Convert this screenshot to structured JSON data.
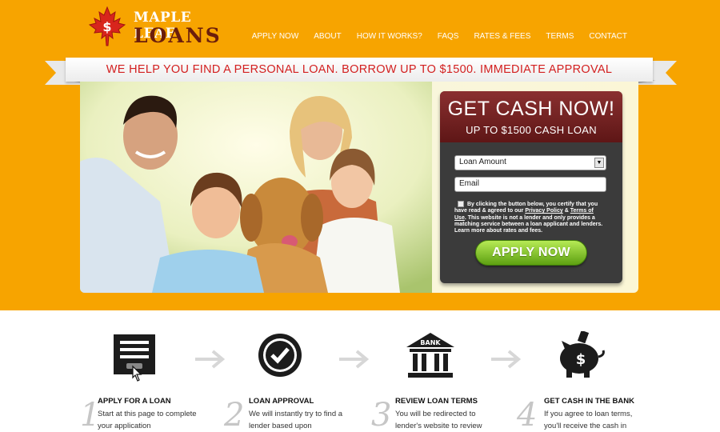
{
  "brand": {
    "line1": "MAPLE LEAF",
    "line2": "LOANS",
    "symbol": "$"
  },
  "nav": [
    "APPLY NOW",
    "ABOUT",
    "HOW IT WORKS?",
    "FAQS",
    "RATES & FEES",
    "TERMS",
    "CONTACT"
  ],
  "banner": "WE HELP YOU FIND A PERSONAL LOAN. BORROW UP TO $1500. IMMEDIATE APPROVAL",
  "form": {
    "title": "GET CASH NOW!",
    "subtitle": "UP TO $1500 CASH LOAN",
    "loan_amount": "Loan Amount",
    "email": "Email",
    "terms_start": "By clicking the button below, you certify that you have read & agreed to our",
    "privacy": "Privacy Policy",
    "amp": "&",
    "terms_link": "Terms of Use",
    "terms_end": ". This website is not a lender and only provides a matching service between a loan applicant and lenders. Learn more about rates and fees.",
    "button": "APPLY NOW"
  },
  "steps": [
    {
      "num": "1",
      "title": "APPLY FOR A LOAN",
      "text": "Start at this page to complete your application"
    },
    {
      "num": "2",
      "title": "LOAN APPROVAL",
      "text": "We will instantly try to find a lender based upon"
    },
    {
      "num": "3",
      "title": "REVIEW LOAN TERMS",
      "text": "You will be redirected to lender's website to review"
    },
    {
      "num": "4",
      "title": "GET CASH IN THE BANK",
      "text": "If you agree to loan terms, you'll receive the cash in"
    }
  ],
  "bank_label": "BANK",
  "colors": {
    "orange": "#f7a400",
    "red": "#d31f1f",
    "maroon": "#6b1e0c",
    "green": "#7cc22a",
    "panel": "#3b3b3b"
  }
}
